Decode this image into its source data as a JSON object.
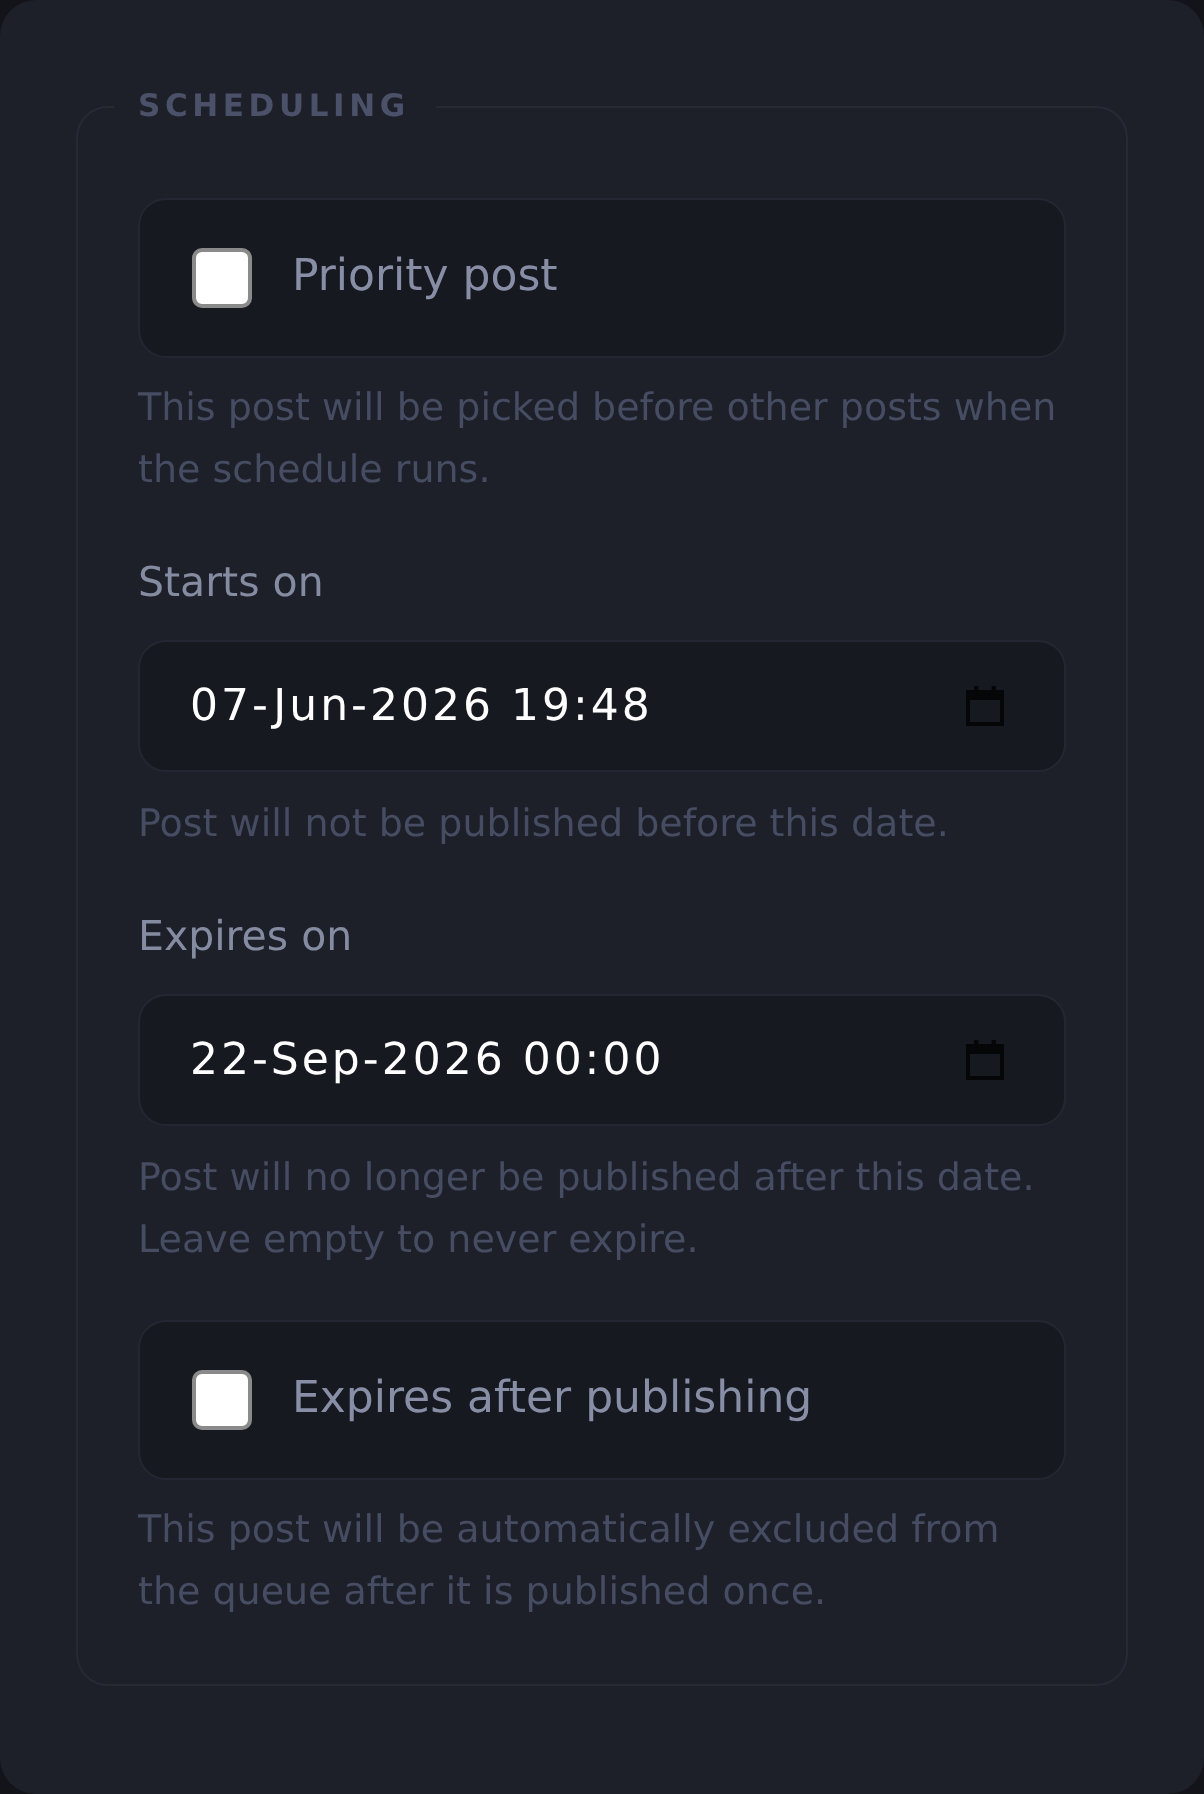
{
  "section": {
    "legend": "SCHEDULING"
  },
  "fields": [
    {
      "kind": "checkbox",
      "label": "Priority post",
      "checked": false,
      "help": "This post will be picked before other posts when the schedule runs."
    },
    {
      "kind": "datetime",
      "label": "Starts on",
      "value": "07-Jun-2026 19:48",
      "help": "Post will not be published before this date."
    },
    {
      "kind": "datetime",
      "label": "Expires on",
      "value": "22-Sep-2026 00:00",
      "help": "Post will no longer be published after this date. Leave empty to never expire."
    },
    {
      "kind": "checkbox",
      "label": "Expires after publishing",
      "checked": false,
      "help": "This post will be automatically excluded from the queue after it is published once."
    }
  ]
}
